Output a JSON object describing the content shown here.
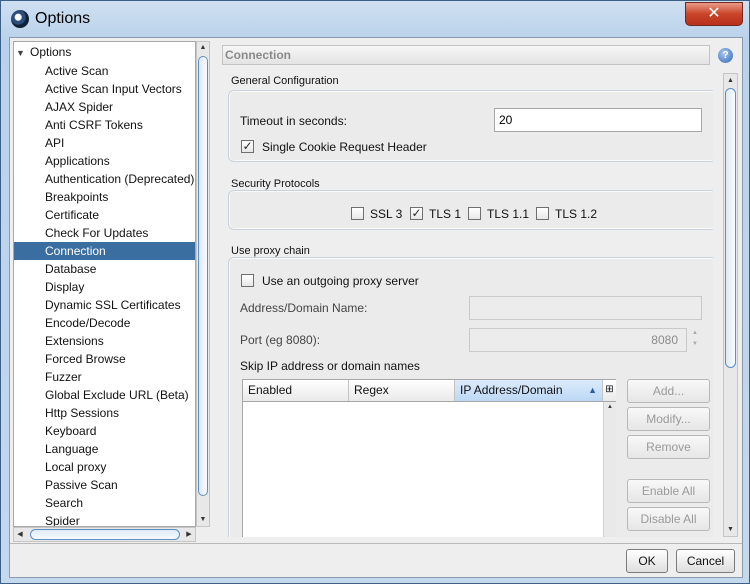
{
  "window": {
    "title": "Options"
  },
  "tree": {
    "root": "Options",
    "items": [
      "Active Scan",
      "Active Scan Input Vectors",
      "AJAX Spider",
      "Anti CSRF Tokens",
      "API",
      "Applications",
      "Authentication (Deprecated)",
      "Breakpoints",
      "Certificate",
      "Check For Updates",
      "Connection",
      "Database",
      "Display",
      "Dynamic SSL Certificates",
      "Encode/Decode",
      "Extensions",
      "Forced Browse",
      "Fuzzer",
      "Global Exclude URL (Beta)",
      "Http Sessions",
      "Keyboard",
      "Language",
      "Local proxy",
      "Passive Scan",
      "Search",
      "Spider"
    ],
    "selected": "Connection"
  },
  "panel": {
    "title": "Connection",
    "general": {
      "title": "General Configuration",
      "timeout_label": "Timeout in seconds:",
      "timeout_value": "20",
      "single_cookie_label": "Single Cookie Request Header",
      "single_cookie_checked": true
    },
    "security": {
      "title": "Security Protocols",
      "protocols": [
        {
          "label": "SSL 3",
          "checked": false
        },
        {
          "label": "TLS 1",
          "checked": true
        },
        {
          "label": "TLS 1.1",
          "checked": false
        },
        {
          "label": "TLS 1.2",
          "checked": false
        }
      ]
    },
    "proxy_chain": {
      "title": "Use proxy chain",
      "use_proxy_label": "Use an outgoing proxy server",
      "use_proxy_checked": false,
      "address_label": "Address/Domain Name:",
      "address_value": "",
      "port_label": "Port (eg 8080):",
      "port_value": "8080",
      "skip_label": "Skip IP address or domain names",
      "table_columns": [
        "Enabled",
        "Regex",
        "IP Address/Domain"
      ],
      "sorted_column": "IP Address/Domain",
      "buttons": {
        "add": "Add...",
        "modify": "Modify...",
        "remove": "Remove",
        "enable_all": "Enable All",
        "disable_all": "Disable All"
      }
    }
  },
  "footer": {
    "ok": "OK",
    "cancel": "Cancel"
  },
  "icons": {
    "app": "zap-logo-icon",
    "close": "close-icon",
    "help": "help-icon",
    "check": "✓",
    "tree_expanded": "triangle-down-icon"
  }
}
